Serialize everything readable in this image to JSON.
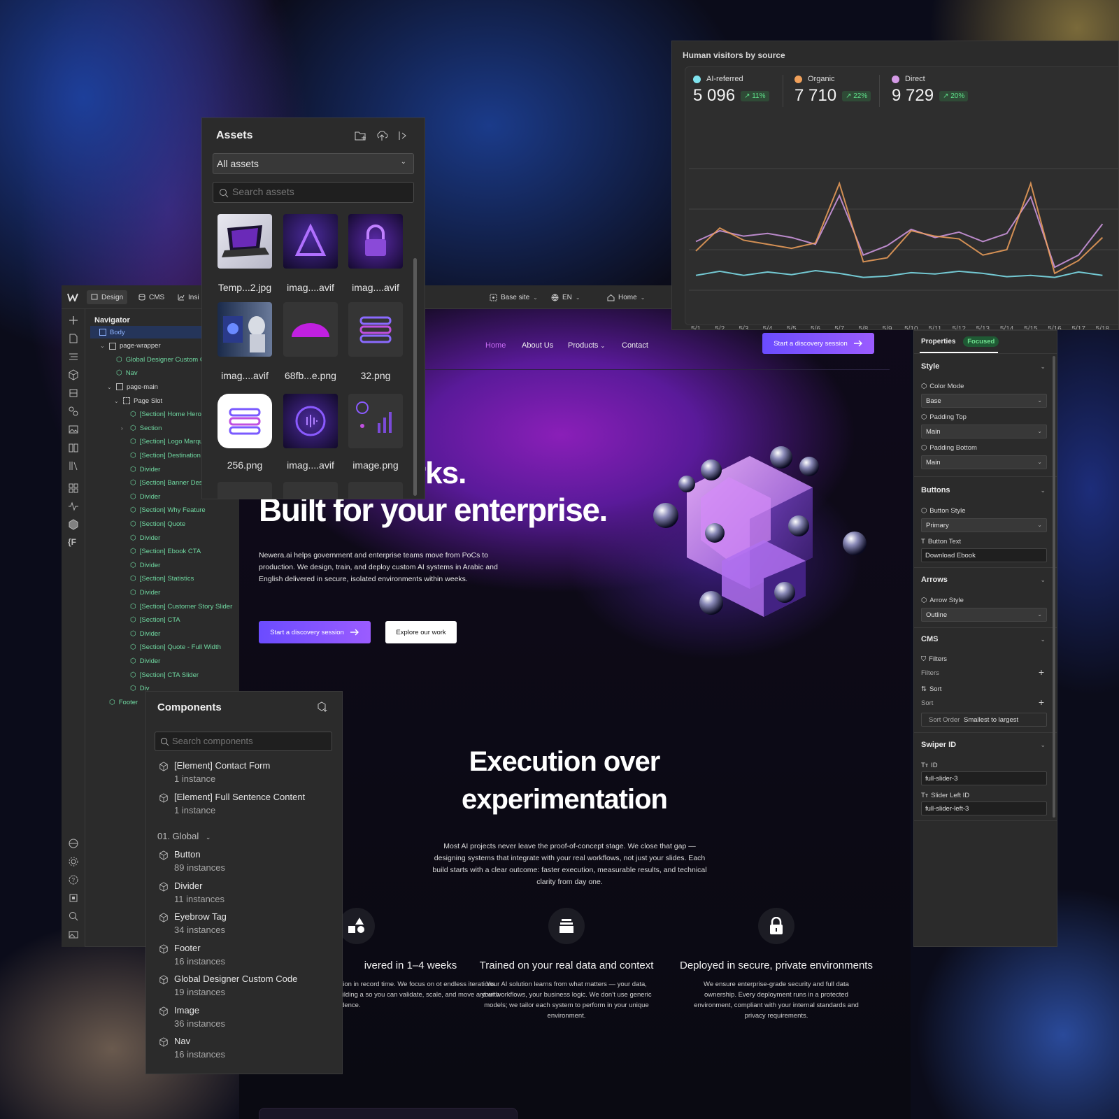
{
  "topbar": {
    "tabs": [
      {
        "label": "Design",
        "icon": "design-icon"
      },
      {
        "label": "CMS",
        "icon": "cms-icon"
      },
      {
        "label": "Insi",
        "icon": "insights-icon"
      }
    ],
    "site": "Base site",
    "lang": "EN",
    "page": "Home"
  },
  "navigator": {
    "title": "Navigator",
    "items": [
      "Body",
      "page-wrapper",
      "Global Designer Custom C",
      "Nav",
      "page-main",
      "Page Slot",
      "[Section] Home Hero",
      "Section",
      "[Section] Logo Marqu",
      "[Section] Destination",
      "Divider",
      "[Section] Banner Dest",
      "Divider",
      "[Section] Why Feature",
      "[Section] Quote",
      "Divider",
      "[Section] Ebook CTA",
      "Divider",
      "[Section] Statistics",
      "Divider",
      "[Section] Customer Story Slider",
      "[Section] CTA",
      "Divider",
      "[Section] Quote - Full Width",
      "Divider",
      "[Section] CTA Slider",
      "Div",
      "Footer"
    ]
  },
  "assets": {
    "title": "Assets",
    "filter": "All assets",
    "search_placeholder": "Search assets",
    "files": [
      "Temp...2.jpg",
      "imag....avif",
      "imag....avif",
      "imag....avif",
      "68fb...e.png",
      "32.png",
      "256.png",
      "imag....avif",
      "image.png"
    ]
  },
  "components": {
    "title": "Components",
    "search_placeholder": "Search components",
    "group": "01. Global",
    "top_items": [
      {
        "name": "[Element] Contact Form",
        "count": "1 instance"
      },
      {
        "name": "[Element] Full Sentence Content",
        "count": "1 instance"
      }
    ],
    "items": [
      {
        "name": "Button",
        "count": "89 instances"
      },
      {
        "name": "Divider",
        "count": "11 instances"
      },
      {
        "name": "Eyebrow Tag",
        "count": "34 instances"
      },
      {
        "name": "Footer",
        "count": "16 instances"
      },
      {
        "name": "Global Designer Custom Code",
        "count": "19 instances"
      },
      {
        "name": "Image",
        "count": "36 instances"
      },
      {
        "name": "Nav",
        "count": "16 instances"
      }
    ]
  },
  "site": {
    "nav": [
      "Home",
      "About Us",
      "Products",
      "Contact"
    ],
    "cta": "Start a discovery session",
    "hero_partial": "rks.",
    "hero_title": "Built for your enterprise.",
    "hero_desc": "Newera.ai helps government and enterprise teams move from PoCs to production. We design, train, and deploy custom AI systems in Arabic and English delivered in secure, isolated environments within weeks.",
    "btn_primary": "Start a discovery session",
    "btn_secondary": "Explore our work",
    "section_title_1": "Execution over",
    "section_title_2": "experimentation",
    "section_desc": "Most AI projects never leave the proof-of-concept stage. We close that gap — designing systems that integrate with your real workflows, not just your slides. Each build starts with a clear outcome: faster execution, measurable results, and technical clarity from day one.",
    "features": [
      {
        "title": "ivered in 1–4 weeks",
        "desc": "oduction in record time. We focus on ot endless iterations — building a so you can validate, scale, and move ard with confidence."
      },
      {
        "title": "Trained on your real data and context",
        "desc": "Your AI solution learns from what matters — your data, your workflows, your business logic. We don’t use generic models; we tailor each system to perform in your unique environment."
      },
      {
        "title": "Deployed in secure, private environments",
        "desc": "We ensure enterprise-grade security and full data ownership. Every deployment runs in a protected environment, compliant with your internal standards and privacy requirements."
      }
    ]
  },
  "chart_data": {
    "type": "line",
    "title": "Human visitors by source",
    "categories": [
      "5/1",
      "5/2",
      "5/3",
      "5/4",
      "5/5",
      "5/6",
      "5/7",
      "5/8",
      "5/9",
      "5/10",
      "5/11",
      "5/12",
      "5/13",
      "5/14",
      "5/15",
      "5/16",
      "5/17",
      "5/18"
    ],
    "stats": [
      {
        "name": "AI-referred",
        "value": "5 096",
        "change": "11%",
        "color": "#7fe3ee"
      },
      {
        "name": "Organic",
        "value": "7 710",
        "change": "22%",
        "color": "#f0a05a"
      },
      {
        "name": "Direct",
        "value": "9 729",
        "change": "20%",
        "color": "#d49ae6"
      }
    ],
    "series": [
      {
        "name": "AI-referred",
        "color": "#7fe3ee",
        "values": [
          22,
          28,
          22,
          27,
          23,
          29,
          25,
          19,
          21,
          26,
          24,
          28,
          25,
          20,
          22,
          19,
          27,
          22
        ]
      },
      {
        "name": "Organic",
        "color": "#f0a05a",
        "values": [
          58,
          92,
          74,
          68,
          62,
          70,
          158,
          42,
          48,
          88,
          80,
          76,
          52,
          60,
          158,
          25,
          44,
          78
        ]
      },
      {
        "name": "Direct",
        "color": "#d49ae6",
        "values": [
          72,
          88,
          80,
          84,
          78,
          68,
          140,
          52,
          66,
          90,
          78,
          86,
          72,
          84,
          138,
          34,
          52,
          98
        ]
      }
    ],
    "ylim": [
      0,
      180
    ],
    "grid": true
  },
  "properties": {
    "tab": "Properties",
    "badge": "Focused",
    "sections": {
      "style": "Style",
      "buttons": "Buttons",
      "arrows": "Arrows",
      "cms": "CMS",
      "swiper": "Swiper ID"
    },
    "color_mode_label": "Color Mode",
    "color_mode": "Base",
    "padding_top_label": "Padding Top",
    "padding_top": "Main",
    "padding_bottom_label": "Padding Bottom",
    "padding_bottom": "Main",
    "button_style_label": "Button Style",
    "button_style": "Primary",
    "button_text_label": "Button Text",
    "button_text": "Download Ebook",
    "arrow_style_label": "Arrow Style",
    "arrow_style": "Outline",
    "filters_label": "Filters",
    "filters_sub": "Filters",
    "sort_label": "Sort",
    "sort_sub": "Sort",
    "sort_order_label": "Sort Order",
    "sort_order": "Smallest to largest",
    "id_label": "ID",
    "id_value": "full-slider-3",
    "slider_left_label": "Slider Left ID",
    "slider_left_value": "full-slider-left-3"
  }
}
